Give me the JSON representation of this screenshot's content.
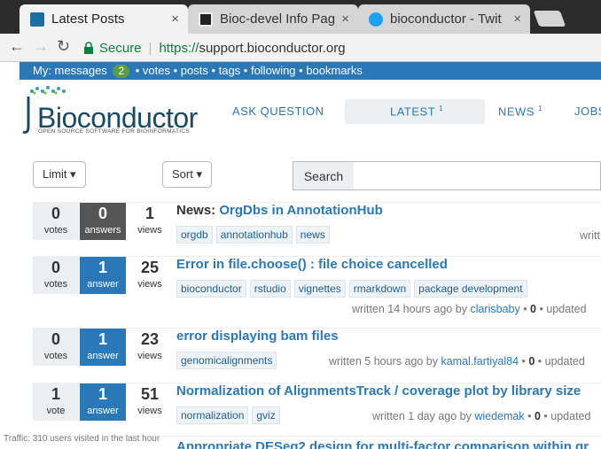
{
  "browser": {
    "tabs": [
      {
        "label": "Latest Posts",
        "close": "×",
        "active": true,
        "icon": "bioconductor-icon"
      },
      {
        "label": "Bioc-devel Info Pag",
        "close": "×",
        "active": false,
        "icon": "mailman-icon"
      },
      {
        "label": "bioconductor - Twit",
        "close": "×",
        "active": false,
        "icon": "twitter-icon"
      }
    ],
    "back": "←",
    "forward": "→",
    "reload": "↻",
    "secure_label": "Secure",
    "url_scheme": "https://",
    "url_host": "support.bioconductor.org"
  },
  "mybar": {
    "prefix": "My: messages",
    "count": "2",
    "links": "• votes • posts • tags • following • bookmarks"
  },
  "logo": {
    "name": "Bioconductor",
    "tagline": "OPEN SOURCE SOFTWARE FOR BIOINFORMATICS"
  },
  "nav": {
    "ask": "ASK QUESTION",
    "latest": "LATEST",
    "latest_count": "1",
    "news": "NEWS",
    "news_count": "1",
    "jobs": "JOBS"
  },
  "controls": {
    "limit": "Limit ▾",
    "sort": "Sort ▾",
    "search": "Search"
  },
  "posts": [
    {
      "votes": "0",
      "votes_label": "votes",
      "answers": "0",
      "answers_label": "answers",
      "views": "1",
      "views_label": "views",
      "prefix": "News: ",
      "title": "OrgDbs in AnnotationHub",
      "tags": [
        "orgdb",
        "annotationhub",
        "news"
      ],
      "meta_text": "writt",
      "author": "",
      "posts": "",
      "updated": ""
    },
    {
      "votes": "0",
      "votes_label": "votes",
      "answers": "1",
      "answers_label": "answer",
      "views": "25",
      "views_label": "views",
      "prefix": "",
      "title": "Error in file.choose() : file choice cancelled",
      "tags": [
        "bioconductor",
        "rstudio",
        "vignettes",
        "rmarkdown",
        "package development"
      ],
      "meta_text": "written 14 hours ago by",
      "author": "clarisbaby",
      "posts": "0",
      "updated": "• updated"
    },
    {
      "votes": "0",
      "votes_label": "votes",
      "answers": "1",
      "answers_label": "answer",
      "views": "23",
      "views_label": "views",
      "prefix": "",
      "title": "error displaying bam files",
      "tags": [
        "genomicalignments"
      ],
      "meta_text": "written 5 hours ago by",
      "author": "kamal.fartiyal84",
      "posts": "0",
      "updated": "• updated"
    },
    {
      "votes": "1",
      "votes_label": "vote",
      "answers": "1",
      "answers_label": "answer",
      "views": "51",
      "views_label": "views",
      "prefix": "",
      "title": "Normalization of AlignmentsTrack / coverage plot by library size",
      "tags": [
        "normalization",
        "gviz"
      ],
      "meta_text": "written 1 day ago by",
      "author": "wiedemak",
      "posts": "0",
      "updated": "• updated"
    },
    {
      "prefix": "",
      "title": "Appropriate DESeq2 design for multi-factor comparison within gr"
    }
  ],
  "traffic": "Traffic: 310 users visited in the last hour"
}
